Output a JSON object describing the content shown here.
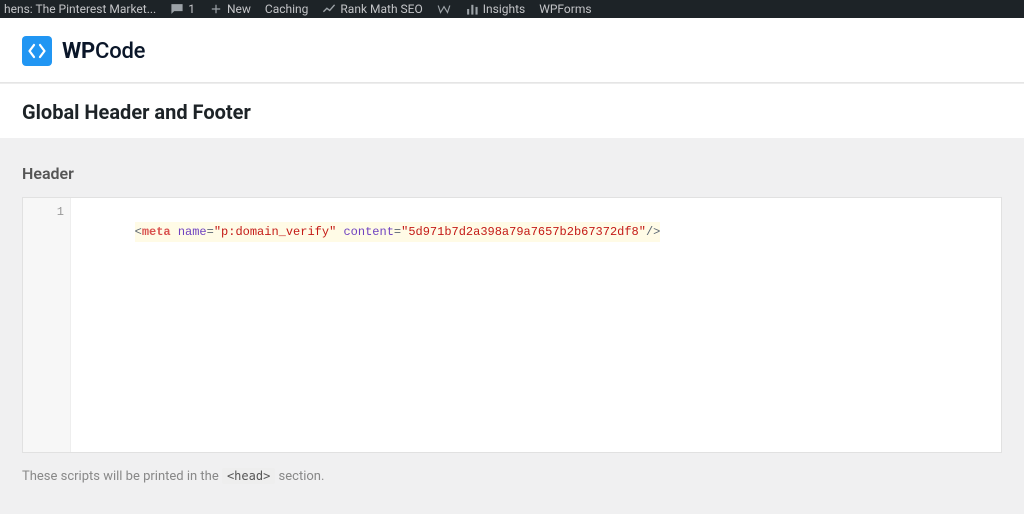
{
  "adminbar": {
    "site_name": "hens: The Pinterest Market...",
    "comments_count": "1",
    "new_label": "New",
    "caching_label": "Caching",
    "rankmath_label": "Rank Math SEO",
    "insights_label": "Insights",
    "wpforms_label": "WPForms"
  },
  "brand": {
    "name_prefix": "WP",
    "name_suffix": "Code"
  },
  "page_title": "Global Header and Footer",
  "header_section": {
    "title": "Header",
    "code": {
      "line_no": "1",
      "tokens": {
        "open_angle": "<",
        "tag": "meta",
        "attr_name_1": "name",
        "eq": "=",
        "q": "\"",
        "val_1": "p:domain_verify",
        "attr_name_2": "content",
        "val_2": "5d971b7d2a398a79a7657b2b67372df8",
        "self_close": "/>"
      }
    },
    "helper_pre": "These scripts will be printed in the ",
    "helper_code": "<head>",
    "helper_post": " section."
  }
}
